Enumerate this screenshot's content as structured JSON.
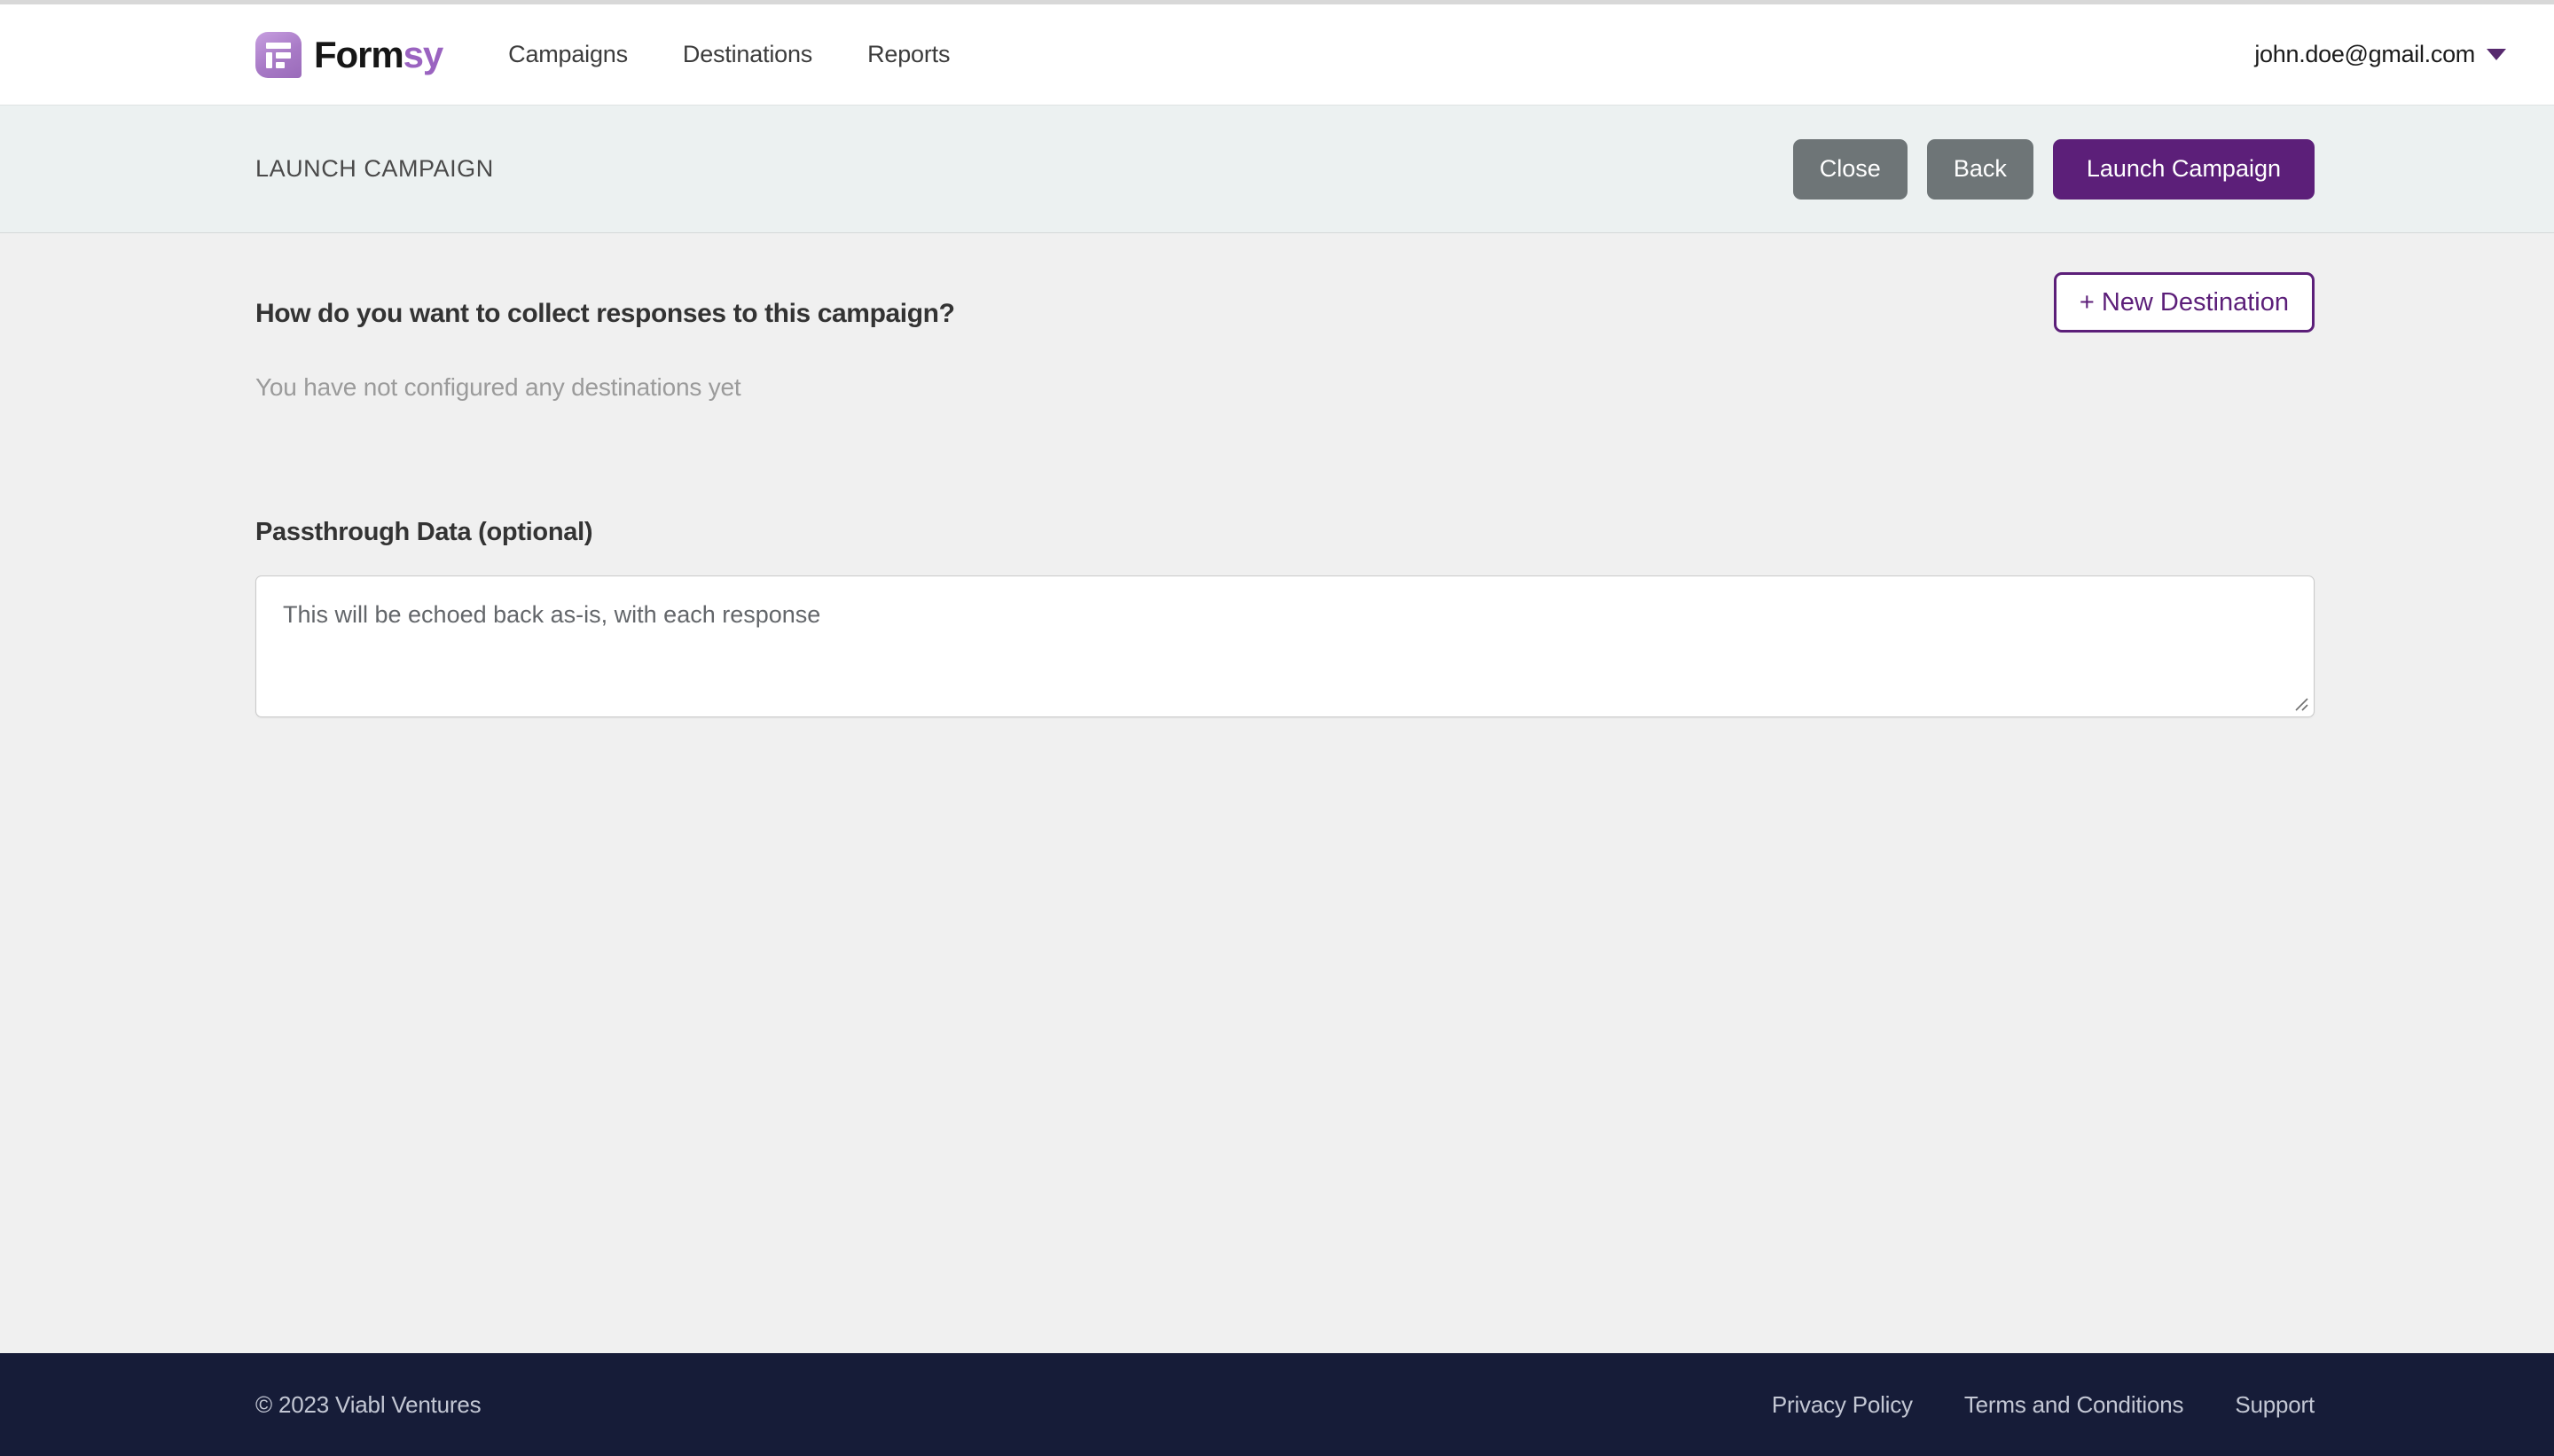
{
  "brand": {
    "name_dark": "Form",
    "name_accent": "sy",
    "logo_icon": "formsy-document-logo-icon",
    "accent_color": "#9a63c0"
  },
  "header": {
    "nav": [
      {
        "label": "Campaigns"
      },
      {
        "label": "Destinations"
      },
      {
        "label": "Reports"
      }
    ],
    "user": {
      "email": "john.doe@gmail.com",
      "caret_icon": "chevron-down-icon"
    }
  },
  "action_bar": {
    "title": "LAUNCH CAMPAIGN",
    "close_label": "Close",
    "back_label": "Back",
    "launch_label": "Launch Campaign",
    "background": "#ecf1f1",
    "primary_color": "#5c1f79",
    "secondary_color": "#6e7577"
  },
  "main": {
    "question": "How do you want to collect responses to this campaign?",
    "new_destination_label": "+ New Destination",
    "empty_state": "You have not configured any destinations yet",
    "passthrough": {
      "label": "Passthrough Data (optional)",
      "value": "",
      "placeholder": "This will be echoed back as-is, with each response",
      "resize_handle_icon": "resize-grip-icon"
    }
  },
  "footer": {
    "copyright": "© 2023 Viabl Ventures",
    "links": [
      {
        "label": "Privacy Policy"
      },
      {
        "label": "Terms and Conditions"
      },
      {
        "label": "Support"
      }
    ],
    "background": "#161c38"
  }
}
